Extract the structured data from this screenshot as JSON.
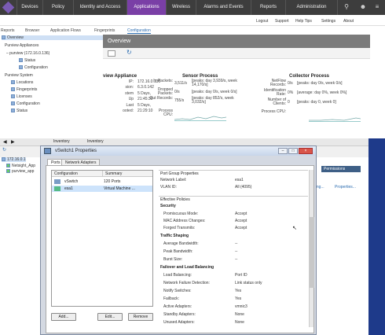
{
  "nav": {
    "items": [
      "Devices",
      "Policy",
      "Identity and Access",
      "Applications",
      "Wireless",
      "Alarms and Events",
      "Reports",
      "Administration"
    ],
    "active": "Applications",
    "accent": "#7a3fa6"
  },
  "subnav": {
    "links": [
      "Logout",
      "Support",
      "Help Tips",
      "Settings",
      "About"
    ],
    "tabs": [
      "Reports",
      "Browser",
      "Application Flows",
      "Fingerprints",
      "Configuration"
    ],
    "active_tab": "Configuration"
  },
  "tree": {
    "overview": "Overview",
    "appliances": "Purview Appliances",
    "host": "purview (172.16.0.136)",
    "status": "Status",
    "configuration": "Configuration",
    "system": "Purview System",
    "locations": "Locations",
    "fingerprints": "Fingerprints",
    "licenses": "Licenses",
    "sys_configuration": "Configuration",
    "sys_status": "Status"
  },
  "overview": {
    "title": "Overview",
    "appliance_title": "view Appliance",
    "appliance": [
      {
        "k": "IP:",
        "v": "172.16.0.136"
      },
      {
        "k": "sion:",
        "v": "6.3.0.142"
      },
      {
        "k": "stem",
        "v": "5 Days,"
      },
      {
        "k": "Up",
        "v": "21:45:30"
      },
      {
        "k": "Last",
        "v": "5 Days,"
      },
      {
        "k": "ooted:",
        "v": "21:29:10"
      }
    ],
    "sensor_title": "Sensor Process",
    "sensor": [
      {
        "k": "In Packets:",
        "v": "3,511/s",
        "extra": "[peaks: day 3,939/s, week 14,170/s]"
      },
      {
        "k": "Dropped Packets:",
        "v": "0/s",
        "extra": "[peaks: day 0/s, week 0/s]"
      },
      {
        "k": "Out Records:",
        "v": "755/s",
        "extra": "[peaks: day 852/s, week 3,032/s]"
      },
      {
        "k": "Process CPU:",
        "v": "",
        "extra": ""
      }
    ],
    "collector_title": "Collector Process",
    "collector": [
      {
        "k": "NetFlow Records:",
        "v": "0/s",
        "extra": "[peaks: day 0/s, week 0/s]"
      },
      {
        "k": "Identification Rate:",
        "v": "0%",
        "extra": "[average: day 0%, week 0%]"
      },
      {
        "k": "Number of Clients:",
        "v": "0",
        "extra": "[peaks: day 0, week 0]"
      },
      {
        "k": "Process CPU:",
        "v": "",
        "extra": ""
      }
    ]
  },
  "vsphere": {
    "tree_host": "172.16.0.1",
    "tree_items": [
      "Netsight_App",
      "purview_app"
    ],
    "breadcrumb": "Inventory",
    "breadcrumb2": "Inventory",
    "right_tab": "Permissions",
    "right_links": [
      "ding...",
      "Properties..."
    ]
  },
  "dialog": {
    "title": "vSwitch1 Properties",
    "tabs": [
      "Ports",
      "Network Adapters"
    ],
    "list_headers": [
      "Configuration",
      "Summary"
    ],
    "list_rows": [
      {
        "name": "vSwitch",
        "summary": "120 Ports"
      },
      {
        "name": "esa1",
        "summary": "Virtual Machine ..."
      }
    ],
    "buttons": [
      "Add...",
      "Edit...",
      "Remove"
    ],
    "port_group_title": "Port Group Properties",
    "network_label_k": "Network Label:",
    "network_label_v": "esa1",
    "vlan_k": "VLAN ID:",
    "vlan_v": "All (4095)",
    "effective_title": "Effective Policies",
    "security_title": "Security",
    "security": [
      {
        "k": "Promiscuous Mode:",
        "v": "Accept"
      },
      {
        "k": "MAC Address Changes:",
        "v": "Accept"
      },
      {
        "k": "Forged Transmits:",
        "v": "Accept"
      }
    ],
    "shaping_title": "Traffic Shaping",
    "shaping": [
      {
        "k": "Average Bandwidth:",
        "v": "--"
      },
      {
        "k": "Peak Bandwidth:",
        "v": "--"
      },
      {
        "k": "Burst Size:",
        "v": "--"
      }
    ],
    "failover_title": "Failover and Load Balancing",
    "failover": [
      {
        "k": "Load Balancing:",
        "v": "Port ID"
      },
      {
        "k": "Network Failure Detection:",
        "v": "Link status only"
      },
      {
        "k": "Notify Switches:",
        "v": "Yes"
      },
      {
        "k": "Failback:",
        "v": "Yes"
      },
      {
        "k": "Active Adapters:",
        "v": "vmnic3"
      },
      {
        "k": "Standby Adapters:",
        "v": "None"
      },
      {
        "k": "Unused Adapters:",
        "v": "None"
      }
    ]
  }
}
